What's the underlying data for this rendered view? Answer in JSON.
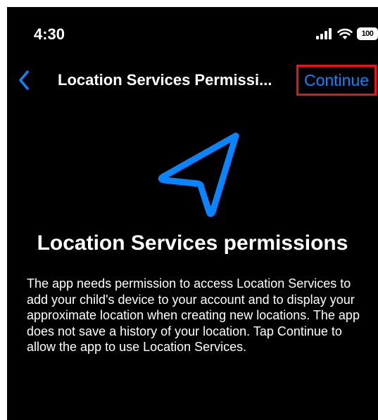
{
  "status_bar": {
    "time": "4:30",
    "battery": "100",
    "icons": [
      "signal-icon",
      "wifi-icon",
      "battery-icon"
    ]
  },
  "nav": {
    "back_icon": "chevron-left-icon",
    "title": "Location Services Permissi...",
    "continue_label": "Continue"
  },
  "content": {
    "hero_icon": "location-arrow-icon",
    "heading": "Location Services permissions",
    "description": "The app needs permission to access Location Services to add your child's device to your account and to display your approximate location when creating new locations. The app does not save a history of your location. Tap Continue to allow the app to use Location Services."
  },
  "colors": {
    "background": "#000000",
    "text": "#ffffff",
    "accent": "#0a84ff",
    "highlight_border": "#e8121b"
  }
}
